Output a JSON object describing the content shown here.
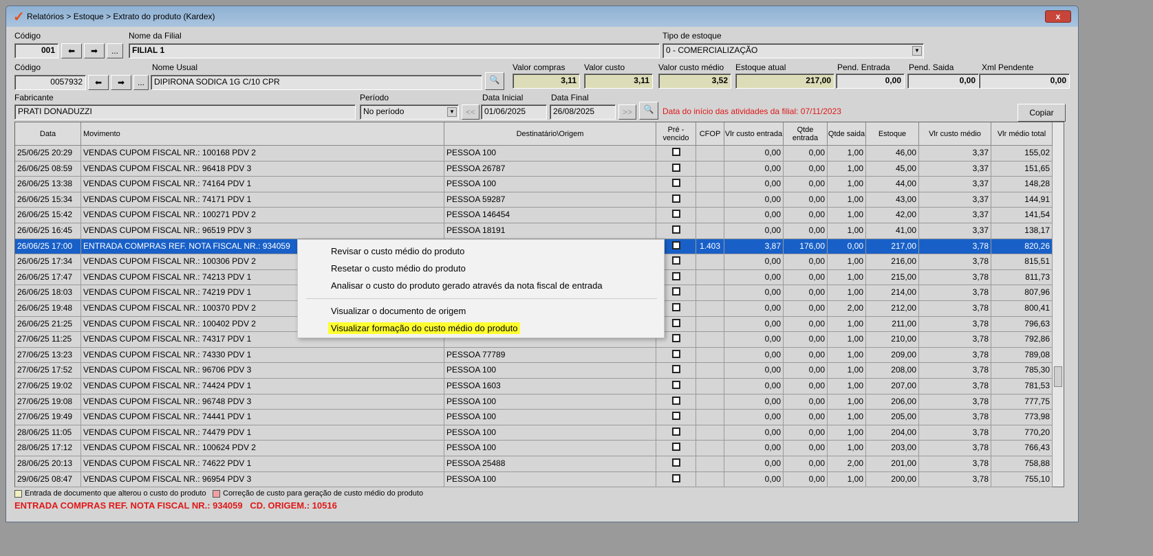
{
  "window": {
    "title": "Relatórios > Estoque > Extrato do produto (Kardex)",
    "close": "x"
  },
  "filial": {
    "codigo_label": "Código",
    "codigo": "001",
    "nome_label": "Nome da Filial",
    "nome": "FILIAL 1",
    "tipo_label": "Tipo de estoque",
    "tipo": "0 - COMERCIALIZAÇÃO"
  },
  "produto": {
    "codigo_label": "Código",
    "codigo": "0057932",
    "nome_label": "Nome Usual",
    "nome": "DIPIRONA SODICA 1G C/10 CPR",
    "more": "..."
  },
  "valores": [
    {
      "label": "Valor compras",
      "value": "3,11"
    },
    {
      "label": "Valor custo",
      "value": "3,11"
    },
    {
      "label": "Valor custo médio",
      "value": "3,52"
    },
    {
      "label": "Estoque atual",
      "value": "217,00"
    },
    {
      "label": "Pend. Entrada",
      "value": "0,00"
    },
    {
      "label": "Pend. Saida",
      "value": "0,00"
    },
    {
      "label": "Xml Pendente",
      "value": "0,00"
    }
  ],
  "fabricante": {
    "label": "Fabricante",
    "value": "PRATI DONADUZZI"
  },
  "periodo": {
    "label": "Período",
    "value": "No período",
    "data_inicial_label": "Data Inicial",
    "data_inicial": "01/06/2025",
    "data_final_label": "Data Final",
    "data_final": "26/08/2025",
    "prev": "<<",
    "next": ">>"
  },
  "aviso": "Data do início das atividades da filial: 07/11/2023",
  "copiar": "Copiar",
  "columns": [
    "Data",
    "Movimento",
    "Destinatário\\Origem",
    "Pré - vencido",
    "CFOP",
    "Vlr custo entrada",
    "Qtde entrada",
    "Qtde saida",
    "Estoque",
    "Vlr custo médio",
    "Vlr médio total"
  ],
  "rows": [
    [
      "25/06/25 20:29",
      "VENDAS CUPOM FISCAL NR.: 100168  PDV  2",
      "PESSOA 100",
      "",
      "0,00",
      "0,00",
      "1,00",
      "46,00",
      "3,37",
      "155,02"
    ],
    [
      "26/06/25 08:59",
      "VENDAS CUPOM FISCAL NR.: 96418  PDV  3",
      "PESSOA 26787",
      "",
      "0,00",
      "0,00",
      "1,00",
      "45,00",
      "3,37",
      "151,65"
    ],
    [
      "26/06/25 13:38",
      "VENDAS CUPOM FISCAL NR.: 74164  PDV  1",
      "PESSOA 100",
      "",
      "0,00",
      "0,00",
      "1,00",
      "44,00",
      "3,37",
      "148,28"
    ],
    [
      "26/06/25 15:34",
      "VENDAS CUPOM FISCAL NR.: 74171  PDV  1",
      "PESSOA 59287",
      "",
      "0,00",
      "0,00",
      "1,00",
      "43,00",
      "3,37",
      "144,91"
    ],
    [
      "26/06/25 15:42",
      "VENDAS CUPOM FISCAL NR.: 100271  PDV  2",
      "PESSOA 146454",
      "",
      "0,00",
      "0,00",
      "1,00",
      "42,00",
      "3,37",
      "141,54"
    ],
    [
      "26/06/25 16:45",
      "VENDAS CUPOM FISCAL NR.: 96519  PDV  3",
      "PESSOA 18191",
      "",
      "0,00",
      "0,00",
      "1,00",
      "41,00",
      "3,37",
      "138,17"
    ],
    [
      "26/06/25 17:00",
      "ENTRADA COMPRAS REF. NOTA FISCAL NR.: 934059",
      "",
      "1.403",
      "3,87",
      "176,00",
      "0,00",
      "217,00",
      "3,78",
      "820,26"
    ],
    [
      "26/06/25 17:34",
      "VENDAS CUPOM FISCAL NR.: 100306  PDV  2",
      "",
      "",
      "0,00",
      "0,00",
      "1,00",
      "216,00",
      "3,78",
      "815,51"
    ],
    [
      "26/06/25 17:47",
      "VENDAS CUPOM FISCAL NR.: 74213  PDV  1",
      "",
      "",
      "0,00",
      "0,00",
      "1,00",
      "215,00",
      "3,78",
      "811,73"
    ],
    [
      "26/06/25 18:03",
      "VENDAS CUPOM FISCAL NR.: 74219  PDV  1",
      "",
      "",
      "0,00",
      "0,00",
      "1,00",
      "214,00",
      "3,78",
      "807,96"
    ],
    [
      "26/06/25 19:48",
      "VENDAS CUPOM FISCAL NR.: 100370  PDV  2",
      "",
      "",
      "0,00",
      "0,00",
      "2,00",
      "212,00",
      "3,78",
      "800,41"
    ],
    [
      "26/06/25 21:25",
      "VENDAS CUPOM FISCAL NR.: 100402  PDV  2",
      "",
      "",
      "0,00",
      "0,00",
      "1,00",
      "211,00",
      "3,78",
      "796,63"
    ],
    [
      "27/06/25 11:25",
      "VENDAS CUPOM FISCAL NR.: 74317  PDV  1",
      "",
      "",
      "0,00",
      "0,00",
      "1,00",
      "210,00",
      "3,78",
      "792,86"
    ],
    [
      "27/06/25 13:23",
      "VENDAS CUPOM FISCAL NR.: 74330  PDV  1",
      "PESSOA 77789",
      "",
      "0,00",
      "0,00",
      "1,00",
      "209,00",
      "3,78",
      "789,08"
    ],
    [
      "27/06/25 17:52",
      "VENDAS CUPOM FISCAL NR.: 96706  PDV  3",
      "PESSOA 100",
      "",
      "0,00",
      "0,00",
      "1,00",
      "208,00",
      "3,78",
      "785,30"
    ],
    [
      "27/06/25 19:02",
      "VENDAS CUPOM FISCAL NR.: 74424  PDV  1",
      "PESSOA 1603",
      "",
      "0,00",
      "0,00",
      "1,00",
      "207,00",
      "3,78",
      "781,53"
    ],
    [
      "27/06/25 19:08",
      "VENDAS CUPOM FISCAL NR.: 96748  PDV  3",
      "PESSOA 100",
      "",
      "0,00",
      "0,00",
      "1,00",
      "206,00",
      "3,78",
      "777,75"
    ],
    [
      "27/06/25 19:49",
      "VENDAS CUPOM FISCAL NR.: 74441  PDV  1",
      "PESSOA 100",
      "",
      "0,00",
      "0,00",
      "1,00",
      "205,00",
      "3,78",
      "773,98"
    ],
    [
      "28/06/25 11:05",
      "VENDAS CUPOM FISCAL NR.: 74479  PDV  1",
      "PESSOA 100",
      "",
      "0,00",
      "0,00",
      "1,00",
      "204,00",
      "3,78",
      "770,20"
    ],
    [
      "28/06/25 17:12",
      "VENDAS CUPOM FISCAL NR.: 100624  PDV  2",
      "PESSOA 100",
      "",
      "0,00",
      "0,00",
      "1,00",
      "203,00",
      "3,78",
      "766,43"
    ],
    [
      "28/06/25 20:13",
      "VENDAS CUPOM FISCAL NR.: 74622  PDV  1",
      "PESSOA 25488",
      "",
      "0,00",
      "0,00",
      "2,00",
      "201,00",
      "3,78",
      "758,88"
    ],
    [
      "29/06/25 08:47",
      "VENDAS CUPOM FISCAL NR.: 96954  PDV  3",
      "PESSOA 100",
      "",
      "0,00",
      "0,00",
      "1,00",
      "200,00",
      "3,78",
      "755,10"
    ]
  ],
  "selected_row": 6,
  "context_menu": [
    "Revisar o custo médio do produto",
    "Resetar o custo médio do produto",
    "Analisar o custo do produto gerado através da nota fiscal de entrada",
    "Visualizar o documento de origem",
    "Visualizar formação do custo médio do produto"
  ],
  "highlighted_menu_item": 4,
  "legend": [
    {
      "label": "Entrada de documento que alterou o custo do produto",
      "color": "#f0f0c0"
    },
    {
      "label": "Correção de custo para geração de custo médio do produto",
      "color": "#f0a0a0"
    }
  ],
  "status": "ENTRADA COMPRAS REF. NOTA FISCAL NR.: 934059   CD. ORIGEM.: 10516",
  "colors": {
    "selection": "#1860c8",
    "highlight": "#ffff30",
    "warning": "#e01818"
  }
}
